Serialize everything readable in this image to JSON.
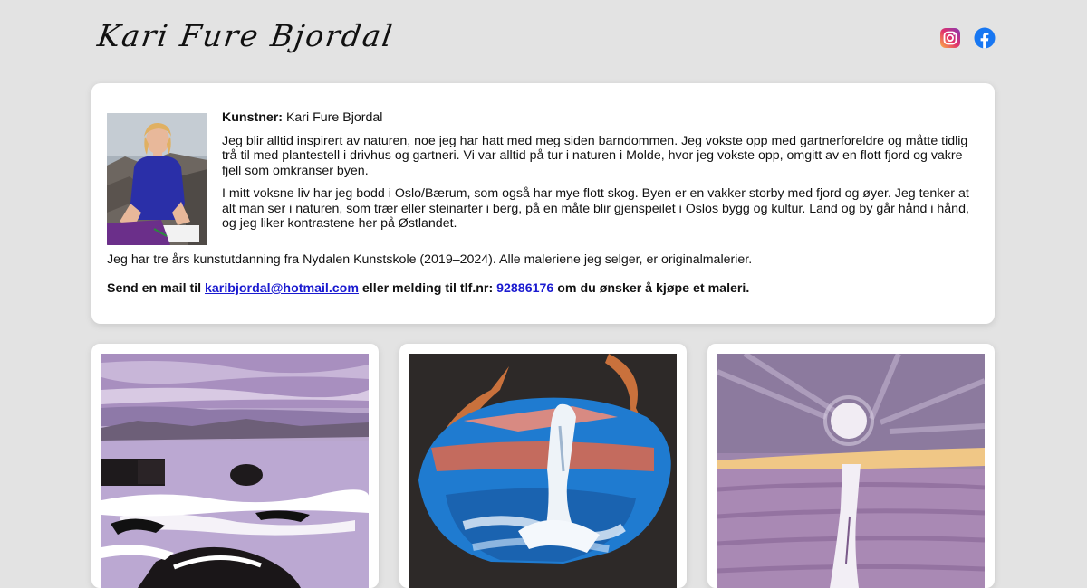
{
  "site": {
    "logo_text": "Kari Fure Bjordal"
  },
  "social": {
    "instagram_icon": "instagram-icon",
    "facebook_icon": "facebook-icon"
  },
  "about": {
    "artist_label": "Kunstner:",
    "artist_name": "Kari Fure Bjordal",
    "paragraph_1": "Jeg blir alltid inspirert av naturen, noe jeg har hatt med meg siden barndommen. Jeg vokste opp med gartnerforeldre og måtte tidlig trå til med plantestell i drivhus og gartneri. Vi var alltid på tur i naturen i Molde, hvor jeg vokste opp, omgitt av en flott fjord og vakre fjell som omkranser byen.",
    "paragraph_2": "I mitt voksne liv har jeg bodd i Oslo/Bærum, som også har mye flott skog. Byen er en vakker storby med fjord og øyer. Jeg tenker at alt man ser i naturen, som trær eller steinarter i berg, på en måte blir gjenspeilet i Oslos bygg og kultur. Land og by går hånd i hånd, og jeg liker kontrastene her på Østlandet.",
    "education": "Jeg har tre års kunstutdanning fra Nydalen Kunstskole (2019–2024). Alle maleriene jeg selger, er originalmalerier.",
    "contact_prefix": "Send en mail til",
    "email": "karibjordal@hotmail.com",
    "contact_middle": "eller melding til tlf.nr:",
    "phone": "92886176",
    "contact_suffix": "om du ønsker å kjøpe et maleri."
  },
  "colors": {
    "page_background": "#e3e3e3",
    "card_background": "#ffffff",
    "link": "#1a1ad0"
  }
}
